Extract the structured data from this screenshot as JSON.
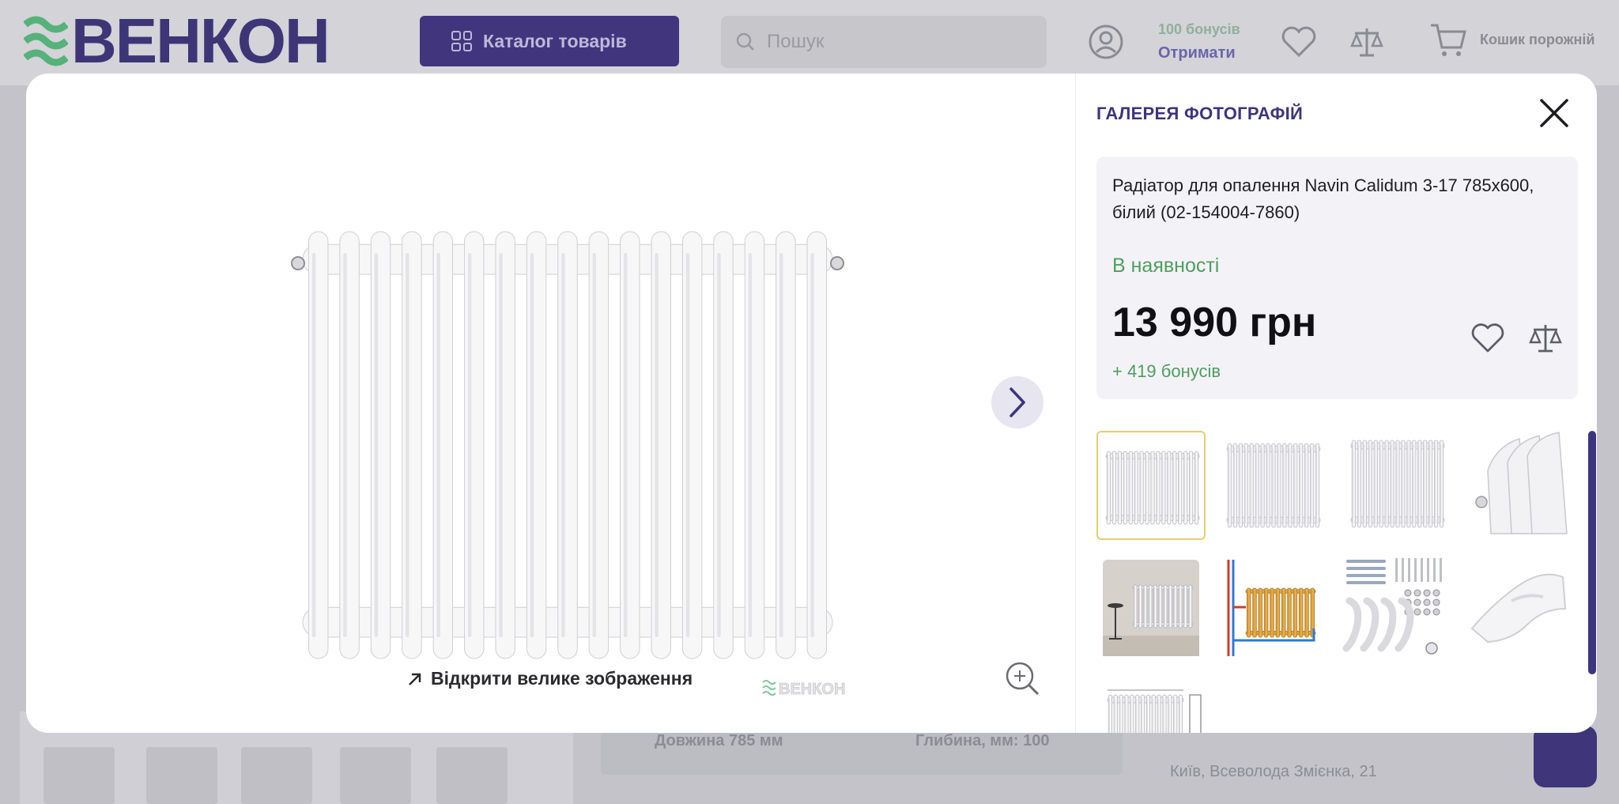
{
  "background": {
    "logo_text": "ВЕНКОН",
    "catalog_button": "Каталог товарів",
    "search_placeholder": "Пошук",
    "bonus_count": "100 бонусів",
    "bonus_action": "Отримати",
    "cart_label": "Кошик порожній",
    "spec_length": "Довжина 785 мм",
    "spec_depth": "Глибина, мм: 100",
    "address": "Київ, Всеволода Змієнка, 21"
  },
  "modal": {
    "title": "ГАЛЕРЕЯ ФОТОГРАФІЙ",
    "product_name": "Радіатор для опалення Navin Calidum 3-17 785x600, білий (02-154004-7860)",
    "stock_status": "В наявності",
    "price": "13 990 грн",
    "bonus": "+ 419 бонусів",
    "open_large_label": "Відкрити велике зображення",
    "watermark": "ВЕНКОН",
    "thumbnails": [
      {
        "name": "radiator-front",
        "active": true
      },
      {
        "name": "radiator-front-2",
        "active": false
      },
      {
        "name": "radiator-front-3",
        "active": false
      },
      {
        "name": "radiator-side-detail",
        "active": false
      },
      {
        "name": "radiator-interior",
        "active": false
      },
      {
        "name": "radiator-piping-diagram",
        "active": false
      },
      {
        "name": "mounting-kit",
        "active": false
      },
      {
        "name": "bracket-detail",
        "active": false
      },
      {
        "name": "radiator-dimensions",
        "active": false
      }
    ]
  },
  "colors": {
    "brand": "#3d3480",
    "stock_green": "#4e9e5e",
    "active_thumb_border": "#e8cc6c"
  },
  "icons": [
    "search-icon",
    "user-icon",
    "heart-icon",
    "compare-icon",
    "cart-icon",
    "chevron-right-icon",
    "arrow-up-right-icon",
    "zoom-in-icon",
    "close-icon"
  ]
}
